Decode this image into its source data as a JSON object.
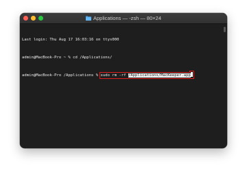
{
  "window": {
    "title": "Applications — -zsh — 80×24",
    "folder_icon": "folder-icon",
    "colors": {
      "background": "#1e1e1e",
      "close": "#ff5f57",
      "minimize": "#febc2e",
      "maximize": "#28c840",
      "highlight_box": "#e11d1d"
    }
  },
  "terminal": {
    "last_login": "Last login: Thu Aug 17 16:03:16 on ttys000",
    "line2_prompt": "admin@MacBook-Pro ~ % ",
    "line2_command": "cd /Applications/",
    "line3_prompt": "admin@MacBook-Pro /Applications % ",
    "line3_command": "sudo rm -rf ",
    "line3_path": "/Applications/MacKeeper.app"
  }
}
